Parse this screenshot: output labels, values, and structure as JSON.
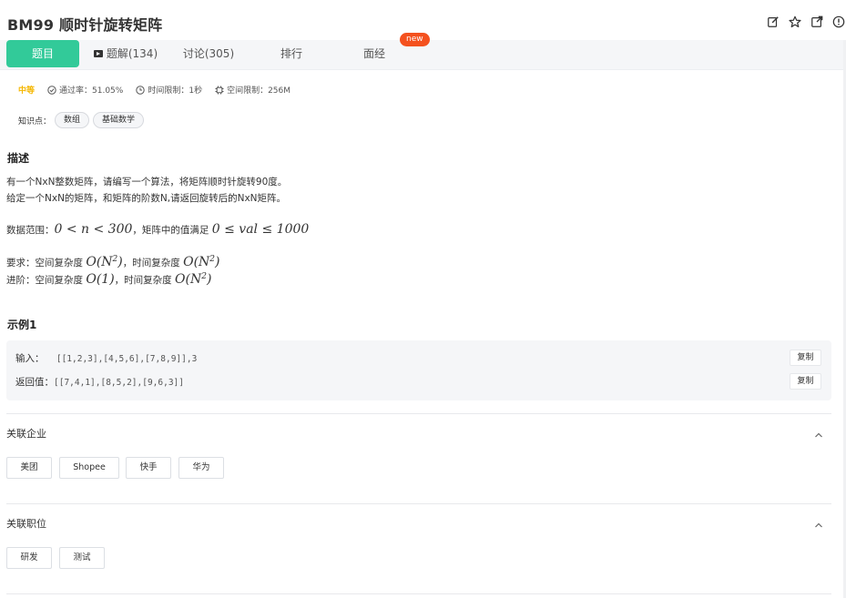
{
  "problem": {
    "title": "BM99  顺时针旋转矩阵"
  },
  "header_icons": [
    "edit-icon",
    "star-icon",
    "share-icon",
    "info-icon"
  ],
  "tabs": [
    {
      "label": "题目",
      "active": true
    },
    {
      "label": "题解(134)",
      "icon": "video-icon"
    },
    {
      "label": "讨论(305)"
    },
    {
      "label": "排行"
    },
    {
      "label": "面经"
    }
  ],
  "new_badge": "new",
  "meta": {
    "difficulty": "中等",
    "pass_rate": "通过率：51.05%",
    "time_limit": "时间限制：1秒",
    "space_limit": "空间限制：256M"
  },
  "knowledge": {
    "label": "知识点：",
    "tags": [
      "数组",
      "基础数学"
    ]
  },
  "description": {
    "heading": "描述",
    "line1": "有一个NxN整数矩阵，请编写一个算法，将矩阵顺时针旋转90度。",
    "line2": "给定一个NxN的矩阵，和矩阵的阶数N,请返回旋转后的NxN矩阵。",
    "range_prefix": "数据范围：",
    "range_formula1": "0 < n < 300",
    "range_mid": "，矩阵中的值满足 ",
    "range_formula2": "0 ≤ val ≤ 1000",
    "req_prefix": "要求：空间复杂度 ",
    "req_space": "O(N2)",
    "req_mid": "，时间复杂度 ",
    "req_time": "O(N2)",
    "adv_prefix": "进阶：空间复杂度 ",
    "adv_space": "O(1)",
    "adv_mid": "，时间复杂度 ",
    "adv_time": "O(N2)"
  },
  "example": {
    "heading": "示例1",
    "input_label": "输入：",
    "input_value": "[[1,2,3],[4,5,6],[7,8,9]],3",
    "output_label": "返回值：",
    "output_value": "[[7,4,1],[8,5,2],[9,6,3]]",
    "copy_label": "复制"
  },
  "related_companies": {
    "title": "关联企业",
    "items": [
      "美团",
      "Shopee",
      "快手",
      "华为"
    ]
  },
  "related_positions": {
    "title": "关联职位",
    "items": [
      "研发",
      "测试"
    ]
  },
  "colors": {
    "accent": "#32ca99",
    "badge": "#f4511e",
    "difficulty": "#f5b700"
  }
}
